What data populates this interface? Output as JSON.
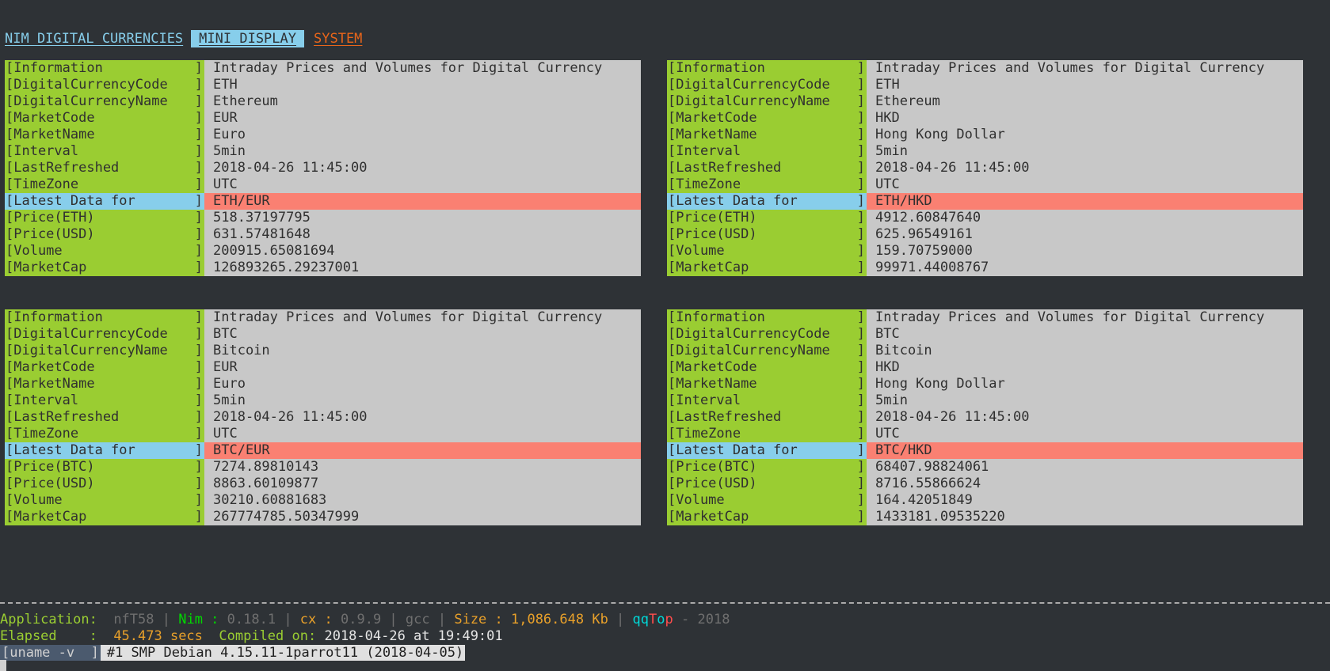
{
  "menu": {
    "tab1": "NIM DIGITAL CURRENCIES",
    "tab2": "MINI DISPLAY",
    "tab3": "SYSTEM"
  },
  "panels": [
    {
      "rows": [
        {
          "label": "[Information",
          "value": "Intraday Prices and Volumes for Digital Currency"
        },
        {
          "label": "[DigitalCurrencyCode",
          "value": "ETH"
        },
        {
          "label": "[DigitalCurrencyName",
          "value": "Ethereum"
        },
        {
          "label": "[MarketCode",
          "value": "EUR"
        },
        {
          "label": "[MarketName",
          "value": "Euro"
        },
        {
          "label": "[Interval",
          "value": "5min"
        },
        {
          "label": "[LastRefreshed",
          "value": "2018-04-26 11:45:00"
        },
        {
          "label": "[TimeZone",
          "value": "UTC"
        },
        {
          "label": "[Latest Data for",
          "value": "ETH/EUR"
        },
        {
          "label": "[Price(ETH)",
          "value": "518.37197795"
        },
        {
          "label": "[Price(USD)",
          "value": "631.57481648"
        },
        {
          "label": "[Volume",
          "value": "200915.65081694"
        },
        {
          "label": "[MarketCap",
          "value": "126893265.29237001"
        }
      ]
    },
    {
      "rows": [
        {
          "label": "[Information",
          "value": "Intraday Prices and Volumes for Digital Currency"
        },
        {
          "label": "[DigitalCurrencyCode",
          "value": "ETH"
        },
        {
          "label": "[DigitalCurrencyName",
          "value": "Ethereum"
        },
        {
          "label": "[MarketCode",
          "value": "HKD"
        },
        {
          "label": "[MarketName",
          "value": "Hong Kong Dollar"
        },
        {
          "label": "[Interval",
          "value": "5min"
        },
        {
          "label": "[LastRefreshed",
          "value": "2018-04-26 11:45:00"
        },
        {
          "label": "[TimeZone",
          "value": "UTC"
        },
        {
          "label": "[Latest Data for",
          "value": "ETH/HKD"
        },
        {
          "label": "[Price(ETH)",
          "value": "4912.60847640"
        },
        {
          "label": "[Price(USD)",
          "value": "625.96549161"
        },
        {
          "label": "[Volume",
          "value": "159.70759000"
        },
        {
          "label": "[MarketCap",
          "value": "99971.44008767"
        }
      ]
    },
    {
      "rows": [
        {
          "label": "[Information",
          "value": "Intraday Prices and Volumes for Digital Currency"
        },
        {
          "label": "[DigitalCurrencyCode",
          "value": "BTC"
        },
        {
          "label": "[DigitalCurrencyName",
          "value": "Bitcoin"
        },
        {
          "label": "[MarketCode",
          "value": "EUR"
        },
        {
          "label": "[MarketName",
          "value": "Euro"
        },
        {
          "label": "[Interval",
          "value": "5min"
        },
        {
          "label": "[LastRefreshed",
          "value": "2018-04-26 11:45:00"
        },
        {
          "label": "[TimeZone",
          "value": "UTC"
        },
        {
          "label": "[Latest Data for",
          "value": "BTC/EUR"
        },
        {
          "label": "[Price(BTC)",
          "value": "7274.89810143"
        },
        {
          "label": "[Price(USD)",
          "value": "8863.60109877"
        },
        {
          "label": "[Volume",
          "value": "30210.60881683"
        },
        {
          "label": "[MarketCap",
          "value": "267774785.50347999"
        }
      ]
    },
    {
      "rows": [
        {
          "label": "[Information",
          "value": "Intraday Prices and Volumes for Digital Currency"
        },
        {
          "label": "[DigitalCurrencyCode",
          "value": "BTC"
        },
        {
          "label": "[DigitalCurrencyName",
          "value": "Bitcoin"
        },
        {
          "label": "[MarketCode",
          "value": "HKD"
        },
        {
          "label": "[MarketName",
          "value": "Hong Kong Dollar"
        },
        {
          "label": "[Interval",
          "value": "5min"
        },
        {
          "label": "[LastRefreshed",
          "value": "2018-04-26 11:45:00"
        },
        {
          "label": "[TimeZone",
          "value": "UTC"
        },
        {
          "label": "[Latest Data for",
          "value": "BTC/HKD"
        },
        {
          "label": "[Price(BTC)",
          "value": "68407.98824061"
        },
        {
          "label": "[Price(USD)",
          "value": "8716.55866624"
        },
        {
          "label": "[Volume",
          "value": "164.42051849"
        },
        {
          "label": "[MarketCap",
          "value": "1433181.09535220"
        }
      ]
    }
  ],
  "footer": {
    "app_label": "Application:",
    "app_name": "nfT58",
    "nim_label": "Nim :",
    "nim_version": "0.18.1",
    "cx_label": "cx :",
    "cx_version": "0.9.9",
    "compiler": "gcc",
    "size": "Size : 1,086.648 Kb",
    "brand_qq": "qq",
    "brand_t": "T",
    "brand_o": "o",
    "brand_p": "p",
    "year": "- 2018",
    "elapsed_label": "Elapsed    :",
    "elapsed_value": "45.473 secs",
    "compiled_label": "Compiled on:",
    "compiled_value": "2018-04-26 at 19:49:01",
    "uname_label": "[uname -v  ]",
    "uname_value": "#1 SMP Debian 4.15.11-1parrot11 (2018-04-05)"
  },
  "colors": {
    "background": "#2e3236",
    "label_green": "#9acd32",
    "value_gray": "#c8c8c8",
    "highlight_blue": "#87ceeb",
    "highlight_salmon": "#fa8072",
    "system_orange": "#e8651a"
  }
}
